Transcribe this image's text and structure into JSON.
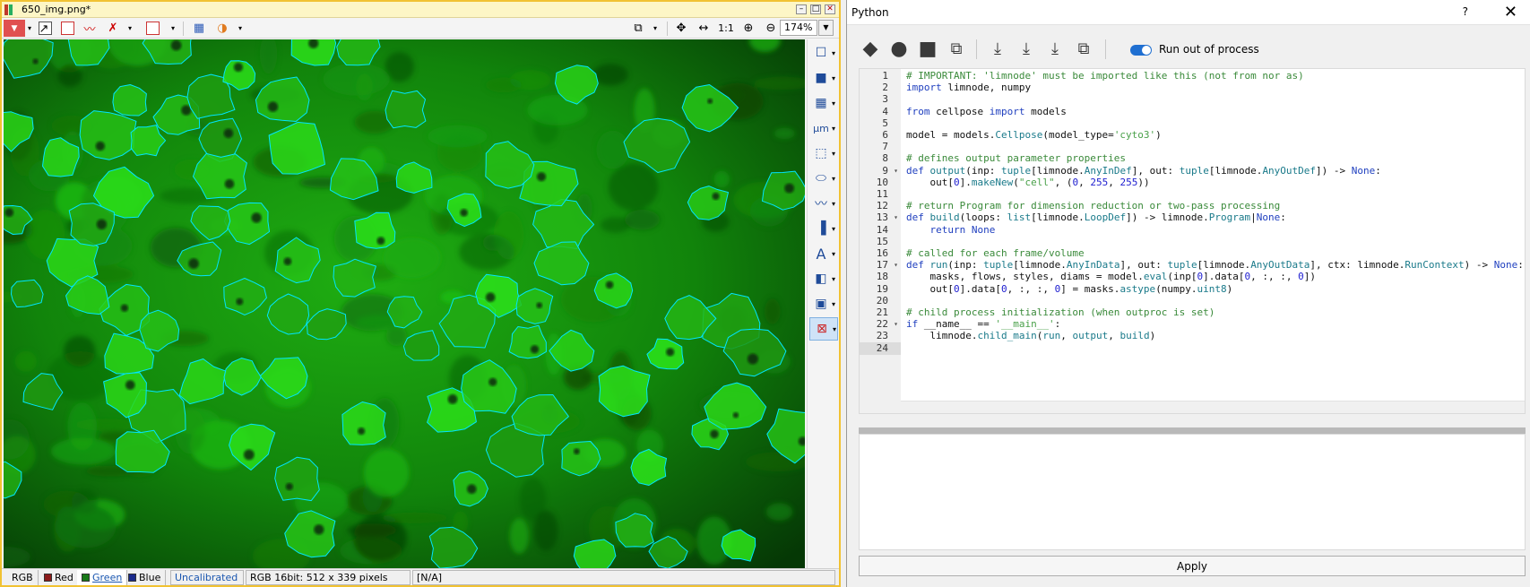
{
  "image_window": {
    "title": "650_img.png*",
    "zoom": "174%",
    "one_to_one": "1:1",
    "status": {
      "channels": [
        {
          "label": "RGB",
          "color": ""
        },
        {
          "label": "Red",
          "color": "#8b1a1a"
        },
        {
          "label": "Green",
          "color": "#1a7a1a"
        },
        {
          "label": "Blue",
          "color": "#1a2a8b"
        }
      ],
      "calibration": "Uncalibrated",
      "image_info": "RGB 16bit: 512 x 339 pixels",
      "value": "[N/A]"
    },
    "overlay_color": "#00e5ff",
    "background_color": "#10a010"
  },
  "python_window": {
    "title": "Python",
    "help": "?",
    "close": "✕",
    "run_out_of_process_label": "Run out of process",
    "run_out_of_process_enabled": true,
    "apply_label": "Apply",
    "code_lines": [
      "# IMPORTANT: 'limnode' must be imported like this (not from nor as)",
      "import limnode, numpy",
      "",
      "from cellpose import models",
      "",
      "model = models.Cellpose(model_type='cyto3')",
      "",
      "# defines output parameter properties",
      "def output(inp: tuple[limnode.AnyInDef], out: tuple[limnode.AnyOutDef]) -> None:",
      "    out[0].makeNew(\"cell\", (0, 255, 255))",
      "",
      "# return Program for dimension reduction or two-pass processing",
      "def build(loops: list[limnode.LoopDef]) -> limnode.Program|None:",
      "    return None",
      "",
      "# called for each frame/volume",
      "def run(inp: tuple[limnode.AnyInData], out: tuple[limnode.AnyOutData], ctx: limnode.RunContext) -> None:",
      "    masks, flows, styles, diams = model.eval(inp[0].data[0, :, :, 0])",
      "    out[0].data[0, :, :, 0] = masks.astype(numpy.uint8)",
      "",
      "# child process initialization (when outproc is set)",
      "if __name__ == '__main__':",
      "    limnode.child_main(run, output, build)",
      ""
    ],
    "line_numbers": [
      "1",
      "2",
      "3",
      "4",
      "5",
      "6",
      "7",
      "8",
      "9",
      "10",
      "11",
      "12",
      "13",
      "14",
      "15",
      "16",
      "17",
      "18",
      "19",
      "20",
      "21",
      "22",
      "23",
      "24"
    ]
  }
}
